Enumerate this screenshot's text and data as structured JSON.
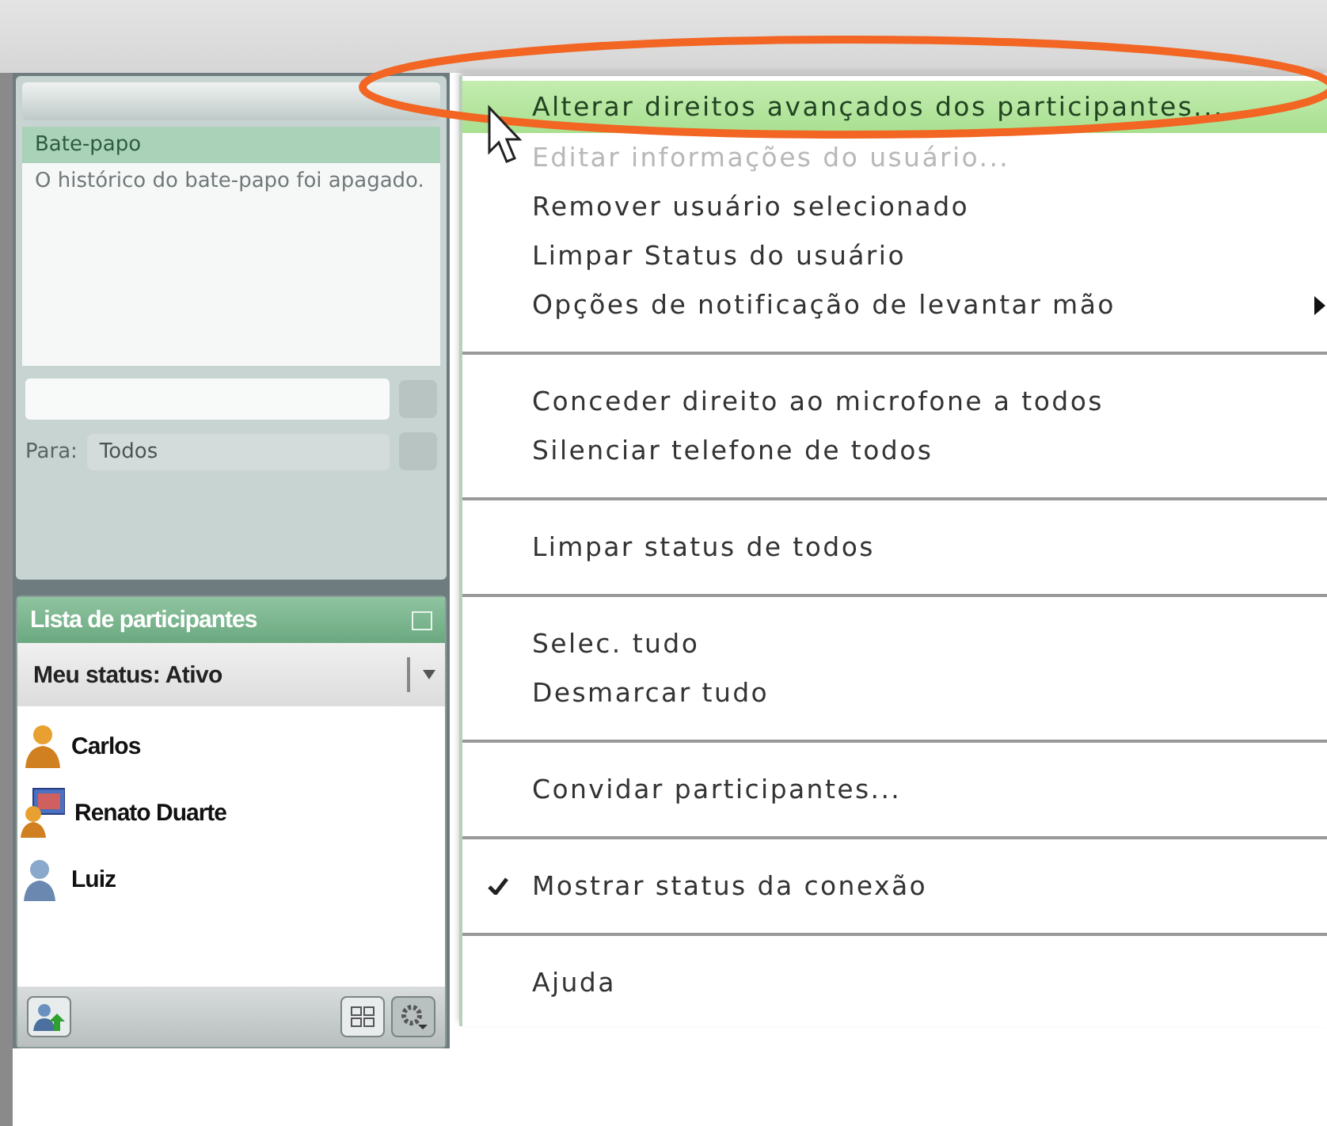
{
  "chat_panel": {
    "title": "Bate-papo",
    "message": "O histórico do bate-papo foi apagado.",
    "to_label": "Para:",
    "to_value": "Todos"
  },
  "participants_panel": {
    "title": "Lista de participantes",
    "status": "Meu status: Ativo",
    "participants": [
      {
        "name": "Carlos",
        "kind": "presenter"
      },
      {
        "name": "Renato Duarte",
        "kind": "sharing"
      },
      {
        "name": "Luiz",
        "kind": "attendee"
      }
    ]
  },
  "context_menu": {
    "items": [
      {
        "kind": "item",
        "label": "Alterar direitos avançados dos participantes...",
        "selected": true,
        "disabled": false,
        "checked": false,
        "submenu": false
      },
      {
        "kind": "item",
        "label": "Editar informações do usuário...",
        "selected": false,
        "disabled": true,
        "checked": false,
        "submenu": false
      },
      {
        "kind": "item",
        "label": "Remover usuário selecionado",
        "selected": false,
        "disabled": false,
        "checked": false,
        "submenu": false
      },
      {
        "kind": "item",
        "label": "Limpar Status do usuário",
        "selected": false,
        "disabled": false,
        "checked": false,
        "submenu": false
      },
      {
        "kind": "item",
        "label": "Opções de notificação de levantar mão",
        "selected": false,
        "disabled": false,
        "checked": false,
        "submenu": true
      },
      {
        "kind": "separator"
      },
      {
        "kind": "item",
        "label": "Conceder direito ao microfone a todos",
        "selected": false,
        "disabled": false,
        "checked": false,
        "submenu": false
      },
      {
        "kind": "item",
        "label": "Silenciar telefone de todos",
        "selected": false,
        "disabled": false,
        "checked": false,
        "submenu": false
      },
      {
        "kind": "separator"
      },
      {
        "kind": "item",
        "label": "Limpar status de todos",
        "selected": false,
        "disabled": false,
        "checked": false,
        "submenu": false
      },
      {
        "kind": "separator"
      },
      {
        "kind": "item",
        "label": "Selec. tudo",
        "selected": false,
        "disabled": false,
        "checked": false,
        "submenu": false
      },
      {
        "kind": "item",
        "label": "Desmarcar tudo",
        "selected": false,
        "disabled": false,
        "checked": false,
        "submenu": false
      },
      {
        "kind": "separator"
      },
      {
        "kind": "item",
        "label": "Convidar participantes...",
        "selected": false,
        "disabled": false,
        "checked": false,
        "submenu": false
      },
      {
        "kind": "separator"
      },
      {
        "kind": "item",
        "label": "Mostrar status da conexão",
        "selected": false,
        "disabled": false,
        "checked": true,
        "submenu": false
      },
      {
        "kind": "separator"
      },
      {
        "kind": "item",
        "label": "Ajuda",
        "selected": false,
        "disabled": false,
        "checked": false,
        "submenu": false
      }
    ]
  }
}
